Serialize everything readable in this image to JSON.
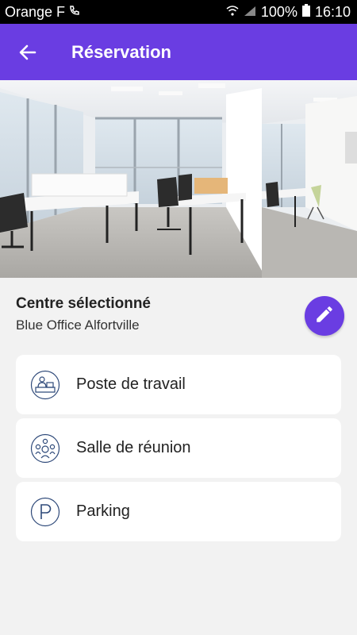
{
  "status": {
    "carrier": "Orange F",
    "battery": "100%",
    "time": "16:10"
  },
  "header": {
    "title": "Réservation"
  },
  "centre": {
    "label": "Centre sélectionné",
    "name": "Blue Office Alfortville"
  },
  "options": [
    {
      "label": "Poste de travail",
      "icon": "desk-icon"
    },
    {
      "label": "Salle de réunion",
      "icon": "meeting-room-icon"
    },
    {
      "label": "Parking",
      "icon": "parking-icon"
    }
  ],
  "colors": {
    "accent": "#6a3de2",
    "icon_outline": "#2f4a7a",
    "background": "#f2f2f2"
  }
}
